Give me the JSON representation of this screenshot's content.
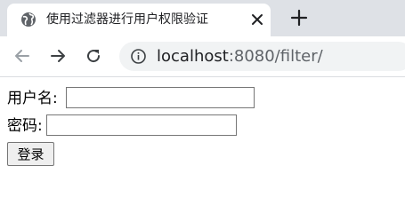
{
  "browser": {
    "tab": {
      "title": "使用过滤器进行用户权限验证",
      "favicon_icon": "globe-icon",
      "close_icon": "close-icon"
    },
    "new_tab_icon": "plus-icon",
    "nav": {
      "back_icon": "arrow-left-icon",
      "forward_icon": "arrow-right-icon",
      "reload_icon": "reload-icon"
    },
    "address": {
      "info_icon": "info-icon",
      "host": "localhost",
      "path": ":8080/filter/"
    }
  },
  "form": {
    "username_label": "用户名:",
    "username_value": "",
    "password_label": "密码:",
    "password_value": "",
    "submit_label": "登录"
  },
  "colors": {
    "tabstrip": "#dee1e6",
    "tab": "#ffffff",
    "omnibox": "#f1f3f4",
    "button": "#efefef"
  }
}
